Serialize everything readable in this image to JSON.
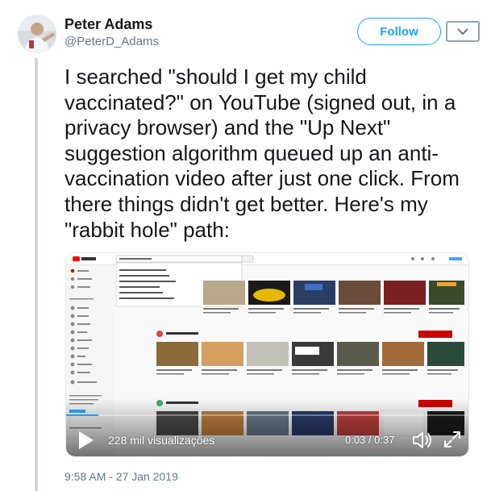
{
  "author": {
    "name": "Peter Adams",
    "handle": "@PeterD_Adams"
  },
  "actions": {
    "follow_label": "Follow",
    "menu_icon": "chevron-down-icon"
  },
  "tweet": {
    "text": "I searched \"should I get my child vaccinated?\" on YouTube (signed out, in a privacy browser) and the \"Up Next\" suggestion algorithm queued up an anti-vaccination video after just one click. From there things didn't get better. Here's my \"rabbit hole\" path:",
    "timestamp": "9:58 AM - 27 Jan 2019"
  },
  "video": {
    "views": "228 mil visualizações",
    "time": "0:03 / 0:37",
    "progress": 0.08,
    "icons": [
      "play-icon",
      "volume-icon",
      "fullscreen-icon"
    ]
  },
  "colors": {
    "accent": "#1da1f2",
    "text": "#14171a",
    "secondary": "#657786",
    "youtube_red": "#ff0000"
  }
}
